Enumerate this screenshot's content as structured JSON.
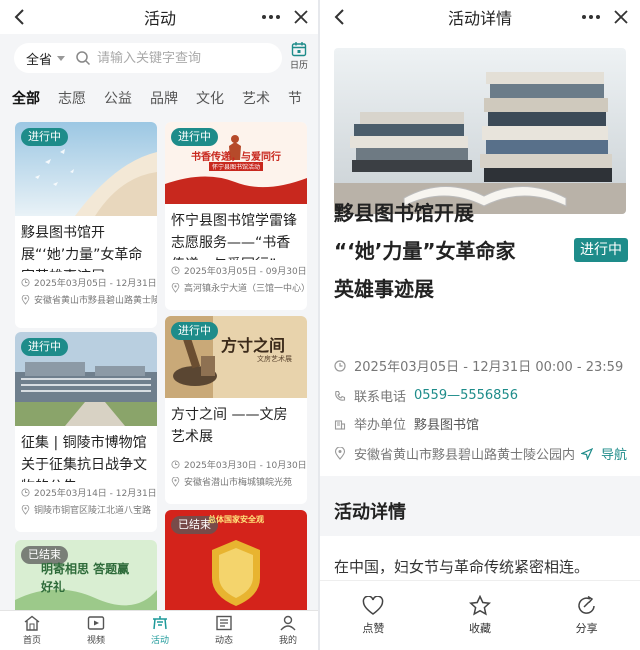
{
  "list_page": {
    "title": "活动",
    "search": {
      "region": "全省",
      "placeholder": "请输入关键字查询",
      "calendar_label": "日历"
    },
    "tabs": [
      "全部",
      "志愿",
      "公益",
      "品牌",
      "文化",
      "艺术",
      "节"
    ],
    "cards": [
      {
        "status": "进行中",
        "title": "黟县图书馆开展“‘她’力量”女革命家英雄事迹展",
        "date": "2025年03月05日 - 12月31日 00:00 - 23:59",
        "location": "安徽省黄山市黟县碧山路黄士陵公园内"
      },
      {
        "status": "进行中",
        "title": "怀宁县图书馆学雷锋志愿服务——“书香传递，与爱同行”",
        "date": "2025年03月05日 - 09月30日",
        "location": "高河镇永宁大道（三馆一中心）",
        "banner_text": "书香传递，与爱同行",
        "banner_sub": "怀宁县图书馆活动"
      },
      {
        "status": "进行中",
        "title": "征集 | 铜陵市博物馆关于征集抗日战争文物的公告",
        "date": "2025年03月14日 - 12月31日",
        "location": "铜陵市铜官区陵江北道八宝路"
      },
      {
        "status": "进行中",
        "title": "方寸之间 ——文房艺术展",
        "date": "2025年03月30日 - 10月30日",
        "location": "安徽省潜山市梅城镇皖光苑",
        "banner_text": "方寸之间",
        "banner_sub": "文房艺术展"
      },
      {
        "status": "已结束",
        "banner_text": "明寄相思 答题赢好礼"
      },
      {
        "status": "已结束",
        "banner_text": "总体国家安全观"
      }
    ],
    "nav": [
      {
        "label": "首页",
        "icon": "home-icon"
      },
      {
        "label": "视频",
        "icon": "video-icon"
      },
      {
        "label": "活动",
        "icon": "activity-icon",
        "active": true
      },
      {
        "label": "动态",
        "icon": "news-icon"
      },
      {
        "label": "我的",
        "icon": "profile-icon"
      }
    ]
  },
  "detail_page": {
    "title": "活动详情",
    "event_title_line1": "黟县图书馆开展",
    "event_title_line2": "“‘她’力量”女革命家",
    "event_title_line3": "英雄事迹展",
    "status": "进行中",
    "time": "2025年03月05日 - 12月31日 00:00 - 23:59",
    "phone_label": "联系电话",
    "phone": "0559—5556856",
    "organizer_label": "举办单位",
    "organizer": "黟县图书馆",
    "address": "安徽省黄山市黟县碧山路黄士陵公园内",
    "navigate_label": "导航",
    "section_title": "活动详情",
    "body_text": "在中国，妇女节与革命传统紧密相连。",
    "actions": [
      {
        "label": "点赞",
        "icon": "heart-icon"
      },
      {
        "label": "收藏",
        "icon": "star-icon"
      },
      {
        "label": "分享",
        "icon": "share-icon"
      }
    ]
  },
  "colors": {
    "accent": "#1e8c8a",
    "nav_active": "#1e9a9a",
    "badge_ended": "#5a5a5a"
  }
}
